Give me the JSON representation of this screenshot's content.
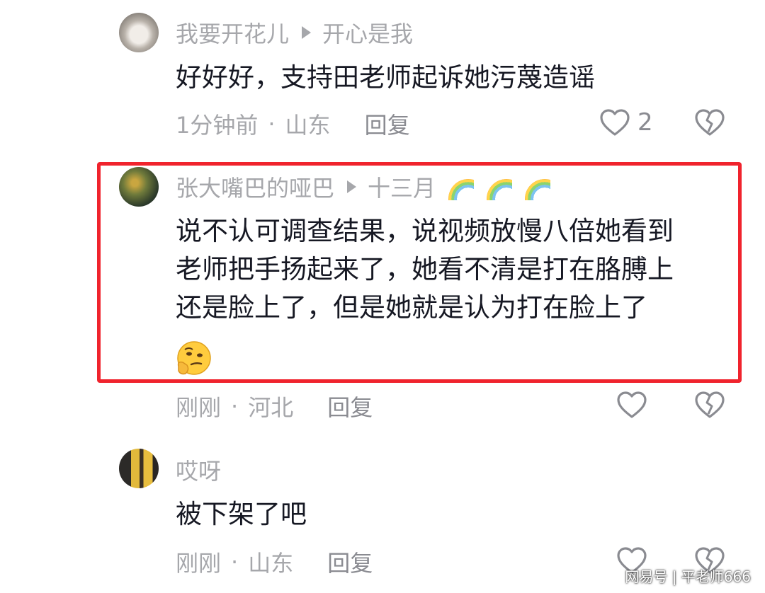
{
  "comments": [
    {
      "user": "我要开花儿",
      "reply_to": "开心是我",
      "text": [
        "好好好，支持田老师起诉她污蔑造谣"
      ],
      "time": "1分钟前",
      "location": "山东",
      "reply_label": "回复",
      "likes": "2"
    },
    {
      "user": "张大嘴巴的哑巴",
      "reply_to": "十三月",
      "text": [
        "说不认可调查结果，说视频放慢八倍她看到",
        "老师把手扬起来了，她看不清是打在胳膊上",
        "还是脸上了，但是她就是认为打在脸上了"
      ],
      "emoji": "thinking-face",
      "time": "刚刚",
      "location": "河北",
      "reply_label": "回复",
      "likes": ""
    },
    {
      "user": "哎呀",
      "text": [
        "被下架了吧"
      ],
      "time": "刚刚",
      "location": "山东",
      "reply_label": "回复",
      "likes": ""
    }
  ],
  "separator": "·",
  "highlight_color": "#f0232d",
  "watermark": "网易号 | 平老师666"
}
